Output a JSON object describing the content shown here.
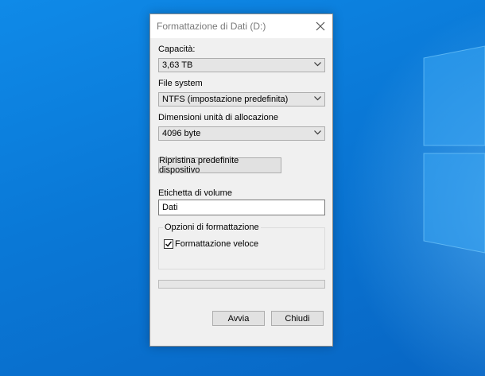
{
  "dialog": {
    "title": "Formattazione di Dati (D:)"
  },
  "capacity": {
    "label": "Capacità:",
    "value": "3,63 TB"
  },
  "file_system": {
    "label": "File system",
    "value": "NTFS (impostazione predefinita)"
  },
  "allocation": {
    "label": "Dimensioni unità di allocazione",
    "value": "4096 byte"
  },
  "restore_button": {
    "label": "Ripristina predefinite dispositivo"
  },
  "volume_label": {
    "label": "Etichetta di volume",
    "value": "Dati"
  },
  "format_options": {
    "legend": "Opzioni di formattazione",
    "quick_format_label": "Formattazione veloce",
    "quick_format_checked": true
  },
  "progress": {
    "fraction": 0
  },
  "actions": {
    "start_label": "Avvia",
    "close_label": "Chiudi"
  },
  "colors": {
    "desktop_blue": "#0a78d7",
    "dialog_bg": "#f0f0f0",
    "progress_green": "#06b025"
  }
}
